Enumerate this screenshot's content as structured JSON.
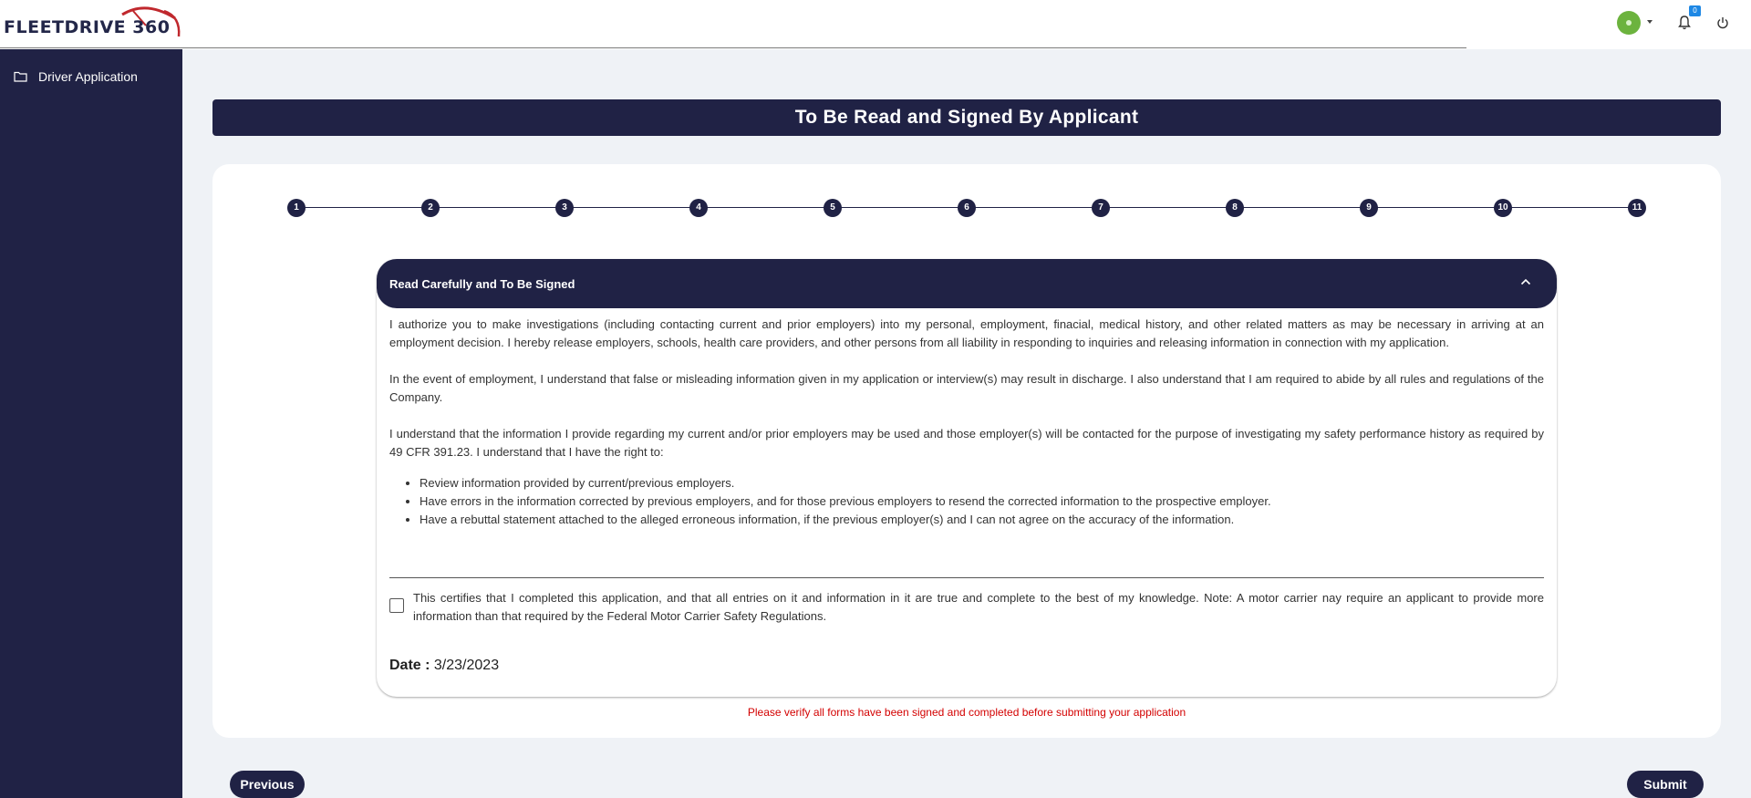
{
  "header": {
    "logo_text": "FLEETDRIVE 360",
    "notification_count": "0"
  },
  "sidebar": {
    "items": [
      {
        "label": "Driver Application",
        "icon": "folder-icon"
      }
    ]
  },
  "page": {
    "title": "To Be Read and Signed By Applicant"
  },
  "stepper": {
    "steps": [
      "1",
      "2",
      "3",
      "4",
      "5",
      "6",
      "7",
      "8",
      "9",
      "10",
      "11"
    ]
  },
  "section": {
    "title": "Read Carefully and To Be Signed",
    "paragraphs": [
      "I authorize you to make investigations (including contacting current and prior employers) into my personal, employment, finacial, medical history, and other related matters as may be necessary in arriving at an employment decision. I hereby release employers, schools, health care providers, and other persons from all liability in responding to inquiries and releasing information in connection with my application.",
      "In the event of employment, I understand that false or misleading information given in my application or interview(s) may result in discharge. I also understand that I am required to abide by all rules and regulations of the Company.",
      "I understand that the information I provide regarding my current and/or prior employers may be used and those employer(s) will be contacted for the purpose of investigating my safety performance history as required by 49 CFR 391.23. I understand that I have the right to:"
    ],
    "rights": [
      "Review information provided by current/previous employers.",
      "Have errors in the information corrected by previous employers, and for those previous employers to resend the corrected information to the prospective employer.",
      "Have a rebuttal statement attached to the alleged erroneous information, if the previous employer(s) and I can not agree on the accuracy of the information."
    ],
    "certification": "This certifies that I completed this application, and that all entries on it and information in it are true and complete to the best of my knowledge. Note: A motor carrier nay require an applicant to provide more information than that required by the Federal Motor Carrier Safety Regulations.",
    "date_label": "Date : ",
    "date_value": "3/23/2023"
  },
  "verify_message": "Please verify all forms have been signed and completed before submitting your application",
  "buttons": {
    "previous": "Previous",
    "submit": "Submit"
  },
  "colors": {
    "navy": "#202245",
    "background": "#eff2f6",
    "error": "#d30000",
    "status_green": "#6cb33e",
    "badge_blue": "#1e88e5"
  }
}
